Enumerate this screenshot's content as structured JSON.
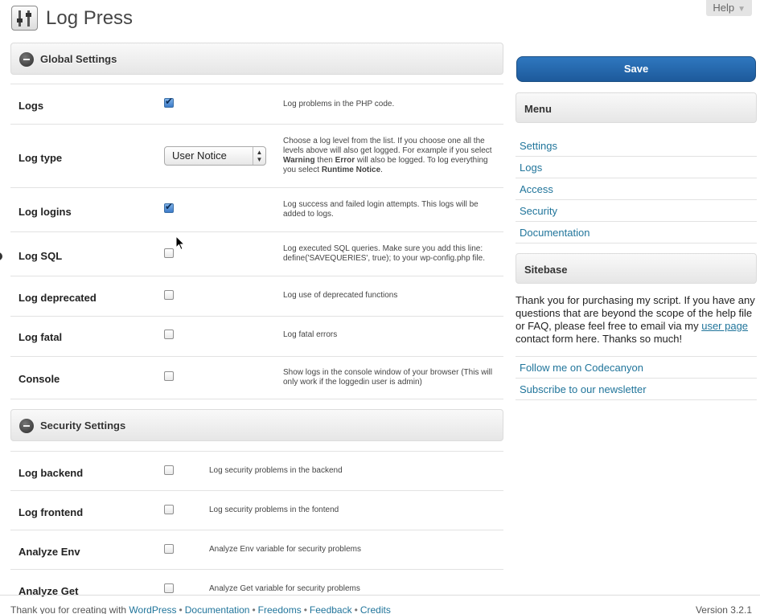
{
  "page": {
    "title": "Log Press",
    "help_label": "Help"
  },
  "sections": {
    "global": "Global Settings",
    "security": "Security Settings"
  },
  "global_rows": [
    {
      "name": "Logs",
      "checked": true,
      "desc": "Log problems in the PHP code."
    },
    {
      "name": "Log type",
      "select_value": "User Notice",
      "desc_parts": [
        "Choose a log level from the list. If you choose one all the levels above will also get logged. For example if you select ",
        "Warning",
        " then ",
        "Error",
        " will also be logged. To log everything you select ",
        "Runtime Notice",
        "."
      ]
    },
    {
      "name": "Log logins",
      "checked": true,
      "desc": "Log success and failed login attempts. This logs will be added to logs."
    },
    {
      "name": "Log SQL",
      "checked": false,
      "desc": "Log executed SQL queries. Make sure you add this line: define('SAVEQUERIES', true); to your wp-config.php file."
    },
    {
      "name": "Log deprecated",
      "checked": false,
      "desc": "Log use of deprecated functions"
    },
    {
      "name": "Log fatal",
      "checked": false,
      "desc": "Log fatal errors"
    },
    {
      "name": "Console",
      "checked": false,
      "desc": "Show logs in the console window of your browser (This will only work if the loggedin user is admin)"
    }
  ],
  "security_rows": [
    {
      "name": "Log backend",
      "checked": false,
      "desc": "Log security problems in the backend"
    },
    {
      "name": "Log frontend",
      "checked": false,
      "desc": "Log security problems in the fontend"
    },
    {
      "name": "Analyze Env",
      "checked": false,
      "desc": "Analyze Env variable for security problems"
    },
    {
      "name": "Analyze Get",
      "checked": false,
      "desc": "Analyze Get variable for security problems"
    }
  ],
  "sidebar": {
    "save_label": "Save",
    "menu_title": "Menu",
    "menu_items": [
      "Settings",
      "Logs",
      "Access",
      "Security",
      "Documentation"
    ],
    "sitebase_title": "Sitebase",
    "sitebase_text_before": "Thank you for purchasing my script. If you have any questions that are beyond the scope of the help file or FAQ, please feel free to email via my ",
    "sitebase_link": "user page",
    "sitebase_text_after": " contact form here. Thanks so much!",
    "links": [
      "Follow me on Codecanyon",
      "Subscribe to our newsletter"
    ]
  },
  "footer": {
    "text_prefix": "Thank you for creating with ",
    "wordpress": "WordPress",
    "links": [
      "Documentation",
      "Freedoms",
      "Feedback",
      "Credits"
    ],
    "version": "Version 3.2.1"
  },
  "colors": {
    "link": "#21759b",
    "save_button": "#1d5a9b"
  }
}
